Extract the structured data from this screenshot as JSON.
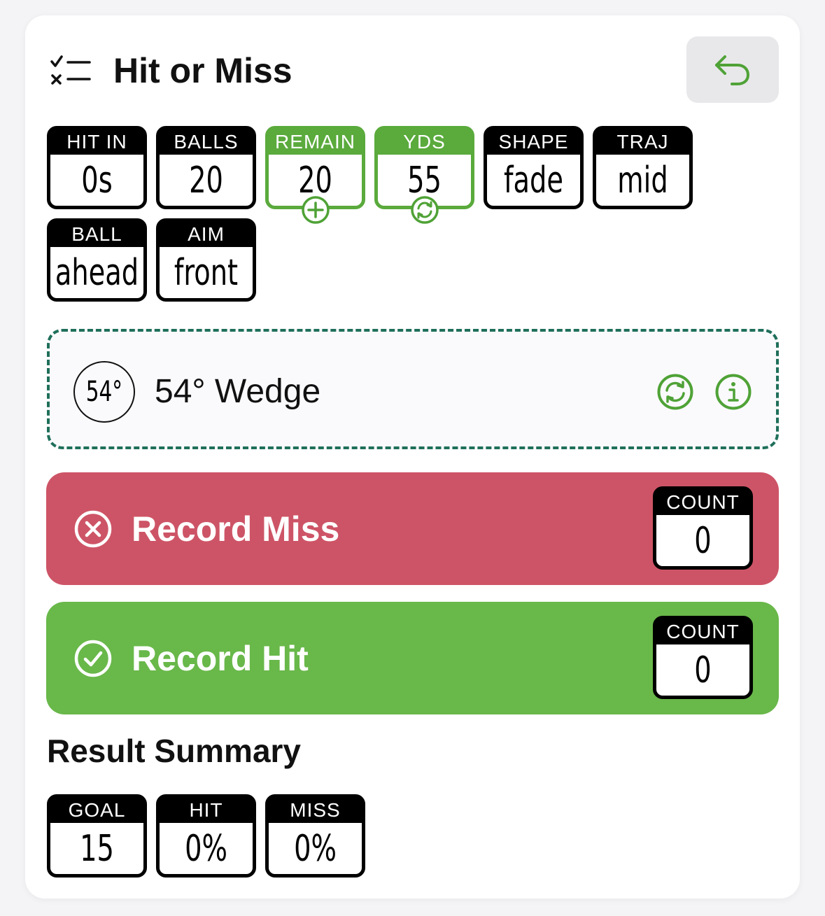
{
  "header": {
    "title": "Hit or Miss"
  },
  "settings": [
    {
      "label": "HIT IN",
      "value": "0s"
    },
    {
      "label": "BALLS",
      "value": "20"
    },
    {
      "label": "REMAIN",
      "value": "20",
      "accent": true,
      "badge": "plus-icon"
    },
    {
      "label": "YDS",
      "value": "55",
      "accent": true,
      "badge": "refresh-icon"
    },
    {
      "label": "SHAPE",
      "value": "fade"
    },
    {
      "label": "TRAJ",
      "value": "mid"
    },
    {
      "label": "BALL",
      "value": "ahead"
    },
    {
      "label": "AIM",
      "value": "front"
    }
  ],
  "club": {
    "badge": "54°",
    "name": "54° Wedge"
  },
  "record_miss": {
    "label": "Record Miss",
    "count_label": "COUNT",
    "count": "0"
  },
  "record_hit": {
    "label": "Record Hit",
    "count_label": "COUNT",
    "count": "0"
  },
  "summary": {
    "title": "Result Summary",
    "tiles": [
      {
        "label": "GOAL",
        "value": "15"
      },
      {
        "label": "HIT",
        "value": "0%"
      },
      {
        "label": "MISS",
        "value": "0%"
      }
    ]
  },
  "colors": {
    "accent_green": "#5aaa3c",
    "miss_red": "#cd5466",
    "hit_green": "#69b84a",
    "dashed_border": "#1f6f5a"
  }
}
